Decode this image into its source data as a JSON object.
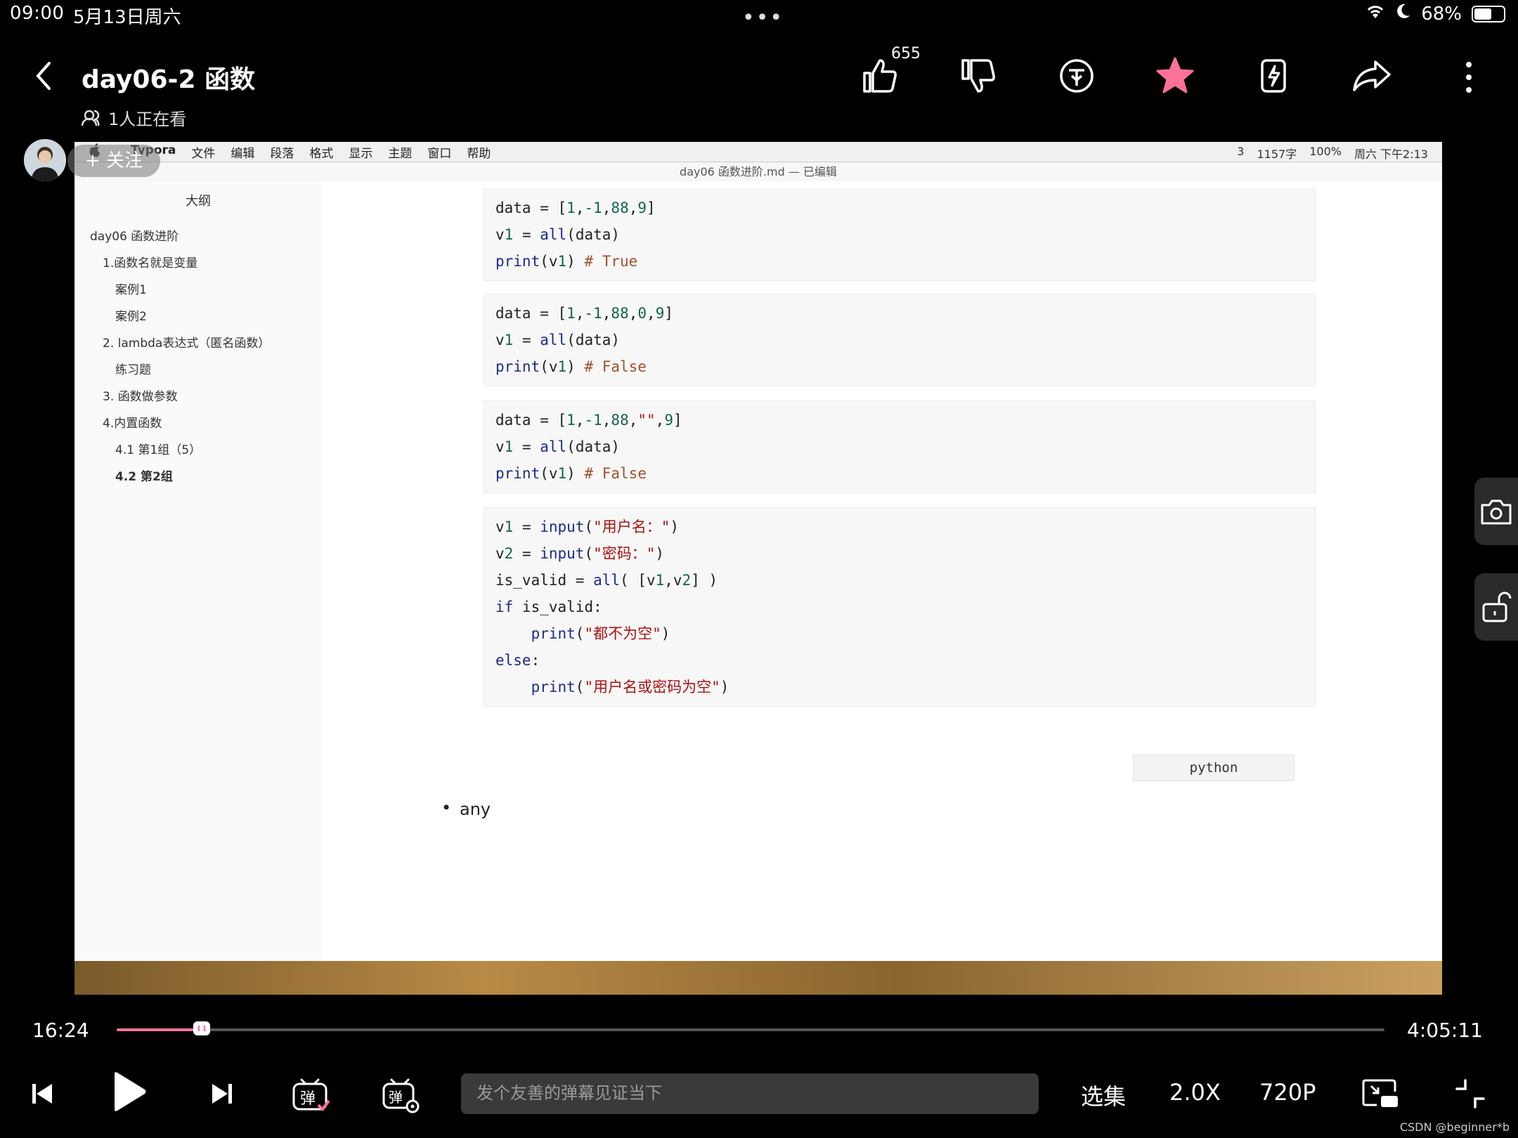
{
  "status_bar": {
    "time": "09:00",
    "date": "5月13日周六",
    "battery": "68%",
    "battery_level": 0.68
  },
  "header": {
    "title": "day06-2 函数",
    "viewers": "1人正在看",
    "like_count": "655",
    "follow_label": "+ 关注",
    "accent_color": "#fb7299"
  },
  "screen_recording": {
    "menu_items": [
      "Typora",
      "文件",
      "编辑",
      "段落",
      "格式",
      "显示",
      "主题",
      "窗口",
      "帮助"
    ],
    "menubar_right": [
      "3",
      "1157字",
      "100%",
      "周六 下午2:13"
    ],
    "window_title": "day06 函数进阶.md — 已编辑",
    "outline_title": "大纲",
    "outline": [
      "day06 函数进阶",
      "1.函数名就是变量",
      "案例1",
      "案例2",
      "2. lambda表达式（匿名函数）",
      "练习题",
      "3. 函数做参数",
      "4.内置函数",
      "4.1 第1组（5）",
      "4.2 第2组"
    ],
    "code_blocks": [
      {
        "lines": [
          "data = [1,-1,88,9]",
          "v1 = all(data)",
          "print(v1) # True"
        ]
      },
      {
        "lines": [
          "data = [1,-1,88,0,9]",
          "v1 = all(data)",
          "print(v1) # False"
        ]
      },
      {
        "lines": [
          "data = [1,-1,88,\"\",9]",
          "v1 = all(data)",
          "print(v1) # False"
        ]
      },
      {
        "lines": [
          "v1 = input(\"用户名：\")",
          "v2 = input(\"密码：\")",
          "is_valid = all( [v1,v2] )",
          "if is_valid:",
          "    print(\"都不为空\")",
          "else:",
          "    print(\"用户名或密码为空\")"
        ]
      }
    ],
    "code_language": "python",
    "bullet": "any"
  },
  "player": {
    "current_time": "16:24",
    "total_time": "4:05:11",
    "progress": 0.0668,
    "danmaku_placeholder": "发个友善的弹幕见证当下",
    "episodes_label": "选集",
    "speed_label": "2.0X",
    "quality_label": "720P"
  },
  "watermark": "CSDN @beginner*b"
}
